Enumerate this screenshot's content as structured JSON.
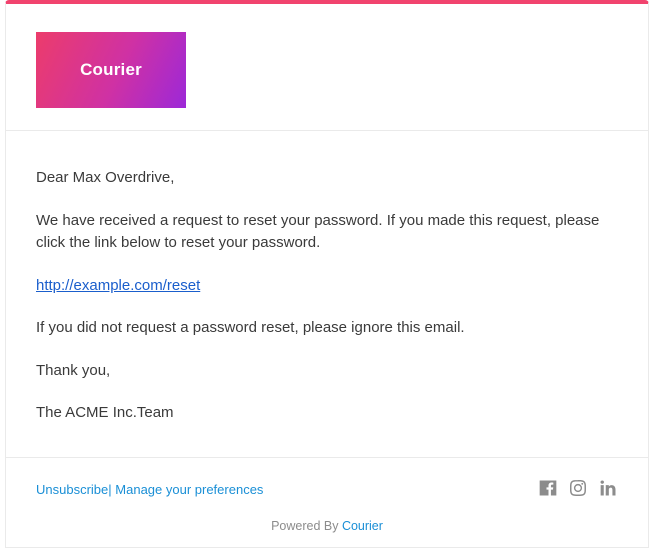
{
  "header": {
    "logo_text": "Courier"
  },
  "body": {
    "greeting": "Dear Max Overdrive,",
    "intro": "We have received a request to reset your password. If you made this request, please click the link below to reset your password.",
    "reset_link_text": "http://example.com/reset",
    "ignore": "If you did not request a password reset, please ignore this email.",
    "thankyou": "Thank you,",
    "signature": "The ACME Inc.Team"
  },
  "footer": {
    "unsubscribe": "Unsubscribe",
    "separator": "|",
    "manage": "Manage your preferences",
    "powered_prefix": "Powered By ",
    "powered_brand": "Courier"
  }
}
